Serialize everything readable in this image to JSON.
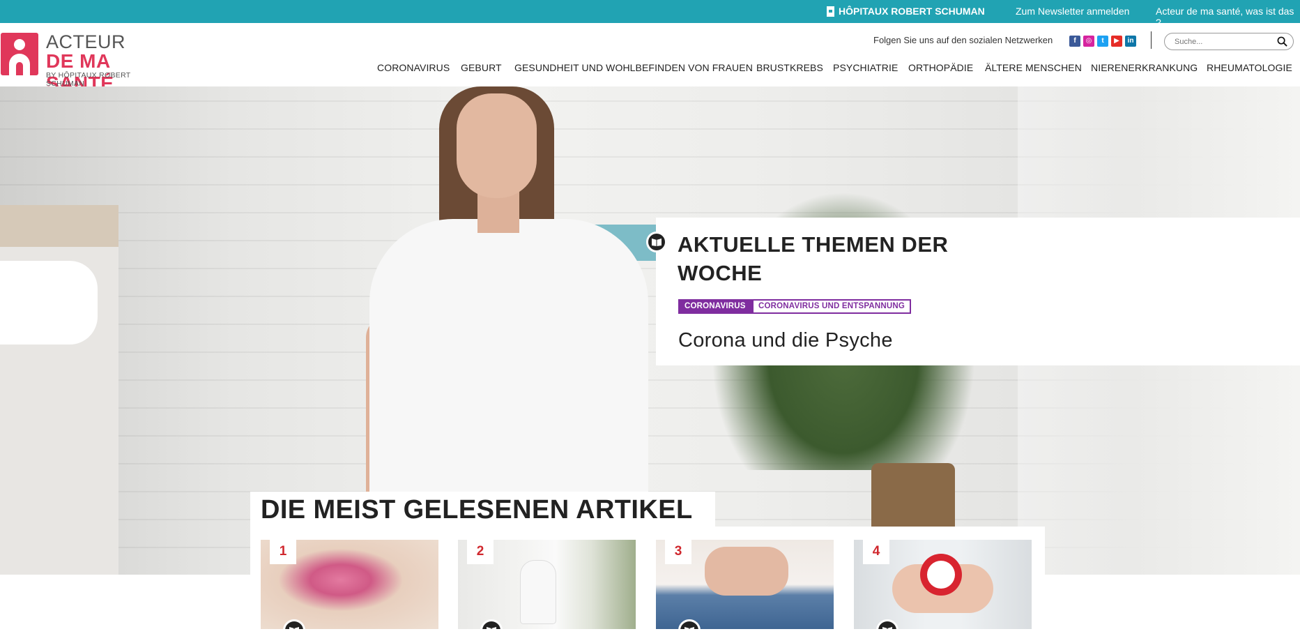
{
  "topbar": {
    "hospitals_link": "HÔPITAUX ROBERT SCHUMAN",
    "newsletter_link": "Zum Newsletter anmelden",
    "about_link": "Acteur de ma santé, was ist das ?"
  },
  "logo": {
    "line1": "ACTEUR",
    "line2": "DE MA SANTÉ",
    "line3": "BY HÔPITAUX ROBERT SCHUMAN"
  },
  "header": {
    "social_label": "Folgen Sie uns auf den sozialen Netzwerken",
    "social_icons": [
      {
        "name": "facebook-icon",
        "glyph": "f",
        "color": "#3b5998"
      },
      {
        "name": "instagram-icon",
        "glyph": "◎",
        "color": "#d6249f"
      },
      {
        "name": "twitter-icon",
        "glyph": "t",
        "color": "#1da1f2"
      },
      {
        "name": "youtube-icon",
        "glyph": "▶",
        "color": "#e52d27"
      },
      {
        "name": "linkedin-icon",
        "glyph": "in",
        "color": "#0e76a8"
      }
    ],
    "search_placeholder": "Suche..."
  },
  "nav": [
    "CORONAVIRUS",
    "GEBURT",
    "GESUNDHEIT UND WOHLBEFINDEN VON FRAUEN",
    "BRUSTKREBS",
    "PSYCHIATRIE",
    "ORTHOPÄDIE",
    "ÄLTERE MENSCHEN",
    "NIERENERKRANKUNG",
    "RHEUMATOLOGIE"
  ],
  "feature": {
    "heading_line1": "AKTUELLE THEMEN DER",
    "heading_line2": "WOCHE",
    "tags": [
      "CORONAVIRUS",
      "CORONAVIRUS UND ENTSPANNUNG"
    ],
    "title": "Corona und die Psyche"
  },
  "most_read": {
    "title": "DIE MEIST GELESENEN ARTIKEL",
    "cards": [
      {
        "rank": "1",
        "image": "pink-flower"
      },
      {
        "rank": "2",
        "image": "woman-meditating"
      },
      {
        "rank": "3",
        "image": "woman-abdomen"
      },
      {
        "rank": "4",
        "image": "red-alarm-clock"
      }
    ]
  },
  "colors": {
    "topbar": "#21a3b3",
    "brand": "#e0375a",
    "tag": "#7f2d9f",
    "rank": "#d0282e"
  }
}
